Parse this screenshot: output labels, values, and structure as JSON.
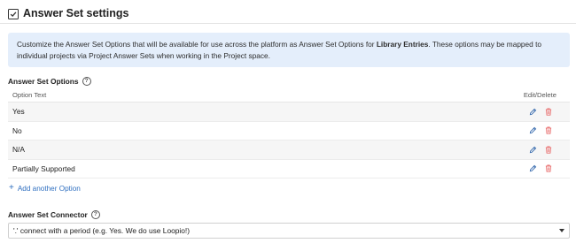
{
  "header": {
    "title": "Answer Set settings",
    "checked": true
  },
  "info": {
    "text_before": "Customize the Answer Set Options that will be available for use across the platform as Answer Set Options for ",
    "text_bold": "Library Entries",
    "text_after": ". These options may be mapped to individual projects via Project Answer Sets when working in the Project space."
  },
  "options_section": {
    "label": "Answer Set Options",
    "col_option": "Option Text",
    "col_actions": "Edit/Delete",
    "rows": [
      {
        "label": "Yes"
      },
      {
        "label": "No"
      },
      {
        "label": "N/A"
      },
      {
        "label": "Partially Supported"
      }
    ],
    "add_label": "Add another Option"
  },
  "connector_section": {
    "label": "Answer Set Connector",
    "selected": "'.' connect with a period (e.g. Yes. We do use Loopio!)"
  },
  "colors": {
    "accent": "#2f6fc0",
    "info_bg": "#e4eefb",
    "edit_icon": "#3d6fb0",
    "delete_icon": "#e86b6b"
  }
}
